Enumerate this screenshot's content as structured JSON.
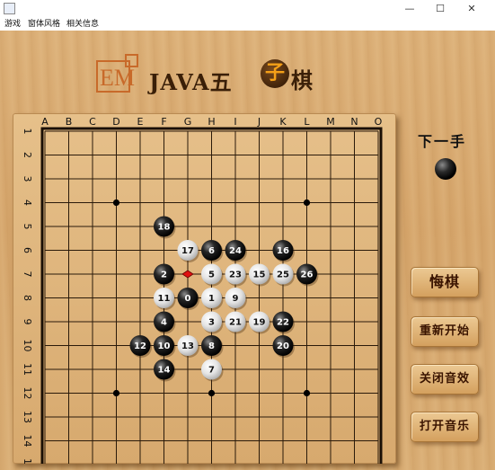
{
  "window": {
    "title": "",
    "min_glyph": "—",
    "max_glyph": "☐",
    "close_glyph": "✕"
  },
  "menu": {
    "items": [
      "游戏",
      "窗体风格",
      "相关信息"
    ]
  },
  "logo": {
    "em_text": "EM",
    "java_text": "JAVA五",
    "zi_text": "子",
    "qi_text": "棋"
  },
  "board": {
    "size": 15,
    "columns": [
      "A",
      "B",
      "C",
      "D",
      "E",
      "F",
      "G",
      "H",
      "I",
      "J",
      "K",
      "L",
      "M",
      "N",
      "O"
    ],
    "rows": [
      "1",
      "2",
      "3",
      "4",
      "5",
      "6",
      "7",
      "8",
      "9",
      "10",
      "11",
      "12",
      "13",
      "14",
      "15"
    ],
    "star_points": [
      [
        "D",
        4
      ],
      [
        "L",
        4
      ],
      [
        "D",
        12
      ],
      [
        "L",
        12
      ],
      [
        "H",
        8
      ],
      [
        "H",
        12
      ]
    ],
    "stones": [
      {
        "n": "0",
        "col": "G",
        "row": 8,
        "color": "black"
      },
      {
        "n": "1",
        "col": "H",
        "row": 8,
        "color": "white"
      },
      {
        "n": "2",
        "col": "F",
        "row": 7,
        "color": "black"
      },
      {
        "n": "3",
        "col": "H",
        "row": 9,
        "color": "white"
      },
      {
        "n": "4",
        "col": "F",
        "row": 9,
        "color": "black"
      },
      {
        "n": "5",
        "col": "H",
        "row": 7,
        "color": "white"
      },
      {
        "n": "6",
        "col": "H",
        "row": 6,
        "color": "black"
      },
      {
        "n": "7",
        "col": "H",
        "row": 11,
        "color": "white"
      },
      {
        "n": "8",
        "col": "H",
        "row": 10,
        "color": "black"
      },
      {
        "n": "9",
        "col": "I",
        "row": 8,
        "color": "white"
      },
      {
        "n": "10",
        "col": "F",
        "row": 10,
        "color": "black"
      },
      {
        "n": "11",
        "col": "F",
        "row": 8,
        "color": "white"
      },
      {
        "n": "12",
        "col": "E",
        "row": 10,
        "color": "black"
      },
      {
        "n": "13",
        "col": "G",
        "row": 10,
        "color": "white"
      },
      {
        "n": "14",
        "col": "F",
        "row": 11,
        "color": "black"
      },
      {
        "n": "15",
        "col": "J",
        "row": 7,
        "color": "white"
      },
      {
        "n": "16",
        "col": "K",
        "row": 6,
        "color": "black"
      },
      {
        "n": "17",
        "col": "G",
        "row": 6,
        "color": "white"
      },
      {
        "n": "18",
        "col": "F",
        "row": 5,
        "color": "black"
      },
      {
        "n": "19",
        "col": "J",
        "row": 9,
        "color": "white"
      },
      {
        "n": "20",
        "col": "K",
        "row": 10,
        "color": "black"
      },
      {
        "n": "21",
        "col": "I",
        "row": 9,
        "color": "white"
      },
      {
        "n": "22",
        "col": "K",
        "row": 9,
        "color": "black"
      },
      {
        "n": "23",
        "col": "I",
        "row": 7,
        "color": "white"
      },
      {
        "n": "24",
        "col": "I",
        "row": 6,
        "color": "black"
      },
      {
        "n": "25",
        "col": "K",
        "row": 7,
        "color": "white"
      },
      {
        "n": "26",
        "col": "L",
        "row": 7,
        "color": "black"
      }
    ],
    "last_move_marker": {
      "col": "G",
      "row": 7,
      "color": "#e01010"
    }
  },
  "side": {
    "next_label": "下一手",
    "next_color": "black"
  },
  "buttons": {
    "undo": "悔棋",
    "restart": "重新开始",
    "close_sound": "关闭音效",
    "open_music": "打开音乐"
  }
}
